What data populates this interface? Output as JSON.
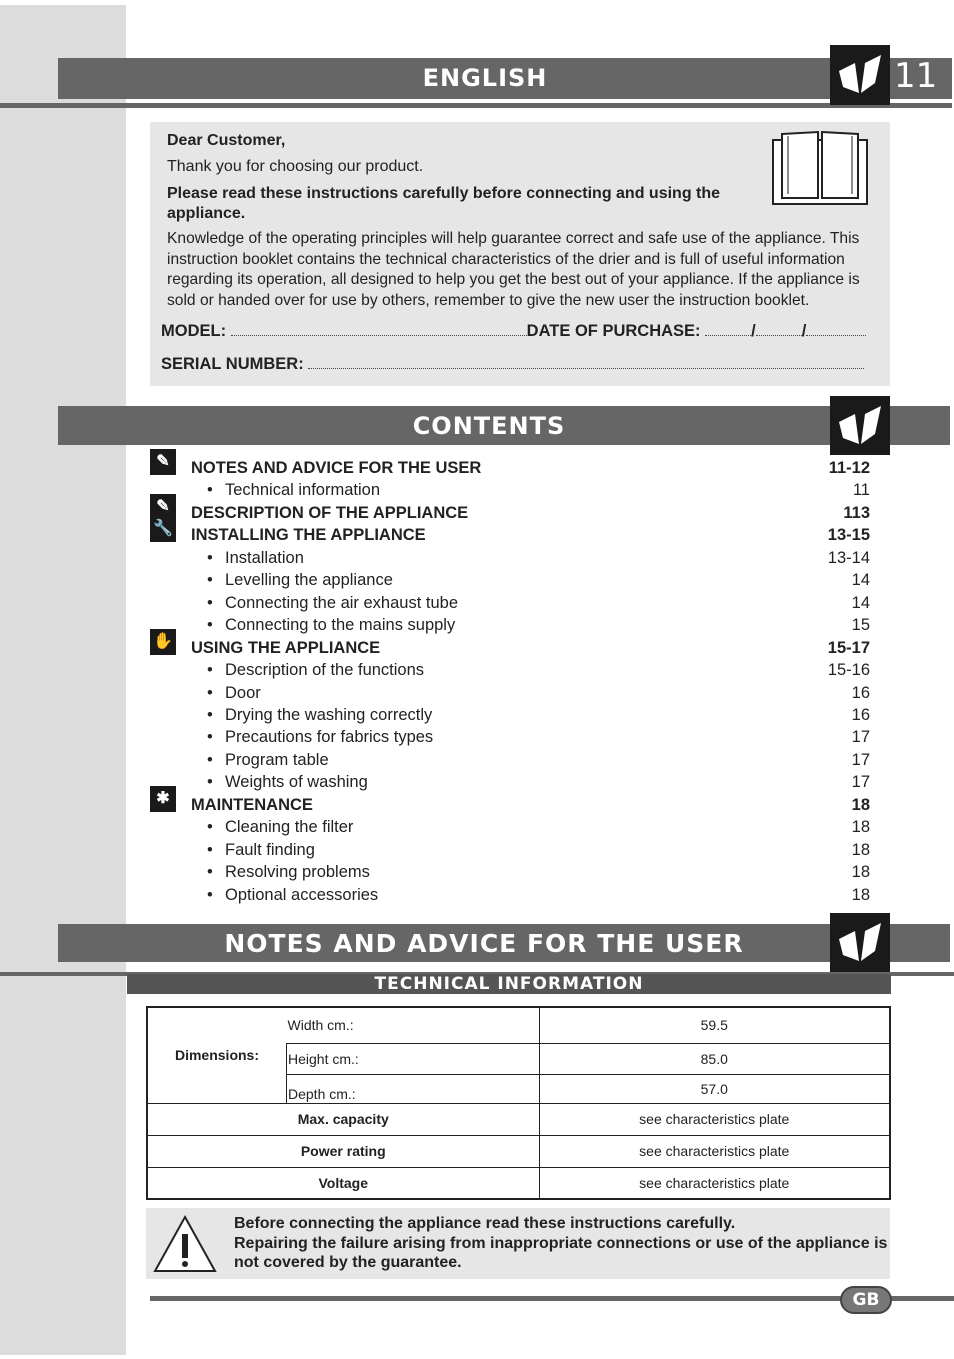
{
  "header": {
    "title": "ENGLISH",
    "page_number": "11"
  },
  "intro": {
    "greeting": "Dear Customer,",
    "thanks": "Thank you for choosing our product.",
    "warning": "Please read these instructions carefully before connecting and using the appliance.",
    "body": "Knowledge of the operating principles will help guarantee correct and safe use of the appliance.  This instruction booklet contains the technical characteristics of the drier and is full of useful information regarding its operation, all designed to help you get the best out of your appliance. If the appliance is sold or handed over for use by others, remember to give the new user the instruction booklet.",
    "model_label": "MODEL:",
    "date_label": "DATE OF PURCHASE:",
    "date_sep": "/",
    "serial_label": "SERIAL NUMBER:"
  },
  "contents": {
    "title": "CONTENTS",
    "items": [
      {
        "type": "main",
        "icon": "book-icon",
        "label": "NOTES AND ADVICE FOR THE USER",
        "page": "11-12"
      },
      {
        "type": "sub",
        "label": "Technical information",
        "page": "11"
      },
      {
        "type": "main",
        "icon": "book-icon",
        "label": "DESCRIPTION OF THE APPLIANCE",
        "page": "113"
      },
      {
        "type": "main",
        "icon": "wrench-icon",
        "label": "INSTALLING THE APPLIANCE",
        "page": "13-15"
      },
      {
        "type": "sub",
        "label": "Installation",
        "page": "13-14"
      },
      {
        "type": "sub",
        "label": "Levelling the appliance",
        "page": "14"
      },
      {
        "type": "sub",
        "label": "Connecting the air exhaust tube",
        "page": "14"
      },
      {
        "type": "sub",
        "label": "Connecting to the mains supply",
        "page": "15"
      },
      {
        "type": "main",
        "icon": "hand-icon",
        "label": "USING THE APPLIANCE",
        "page": "15-17"
      },
      {
        "type": "sub",
        "label": "Description of the functions",
        "page": "15-16"
      },
      {
        "type": "sub",
        "label": "Door",
        "page": "16"
      },
      {
        "type": "sub",
        "label": "Drying the washing correctly",
        "page": "16"
      },
      {
        "type": "sub",
        "label": "Precautions for fabrics types",
        "page": "17"
      },
      {
        "type": "sub",
        "label": "Program table",
        "page": "17"
      },
      {
        "type": "sub",
        "label": "Weights of washing",
        "page": "17"
      },
      {
        "type": "main",
        "icon": "cleaning-hand-icon",
        "label": "MAINTENANCE",
        "page": "18"
      },
      {
        "type": "sub",
        "label": "Cleaning the filter",
        "page": "18"
      },
      {
        "type": "sub",
        "label": "Fault finding",
        "page": "18"
      },
      {
        "type": "sub",
        "label": "Resolving problems",
        "page": "18"
      },
      {
        "type": "sub",
        "label": "Optional accessories",
        "page": "18"
      }
    ]
  },
  "notes": {
    "title": "NOTES AND ADVICE FOR THE USER",
    "subtitle": "TECHNICAL INFORMATION"
  },
  "tech_table": {
    "dimensions_label": "Dimensions:",
    "dimensions": [
      {
        "label": "Width cm.:",
        "value": "59.5"
      },
      {
        "label": "Height cm.:",
        "value": "85.0"
      },
      {
        "label": "Depth cm.:",
        "value": "57.0"
      }
    ],
    "rows": [
      {
        "label": "Max. capacity",
        "value": "see characteristics plate"
      },
      {
        "label": "Power rating",
        "value": "see characteristics plate"
      },
      {
        "label": "Voltage",
        "value": "see characteristics plate"
      }
    ]
  },
  "warning": {
    "line1": "Before connecting the appliance read these instructions carefully.",
    "line2": "Repairing the failure arising from inappropriate connections or use of the appliance is not covered by the guarantee."
  },
  "footer": {
    "country": "GB"
  }
}
